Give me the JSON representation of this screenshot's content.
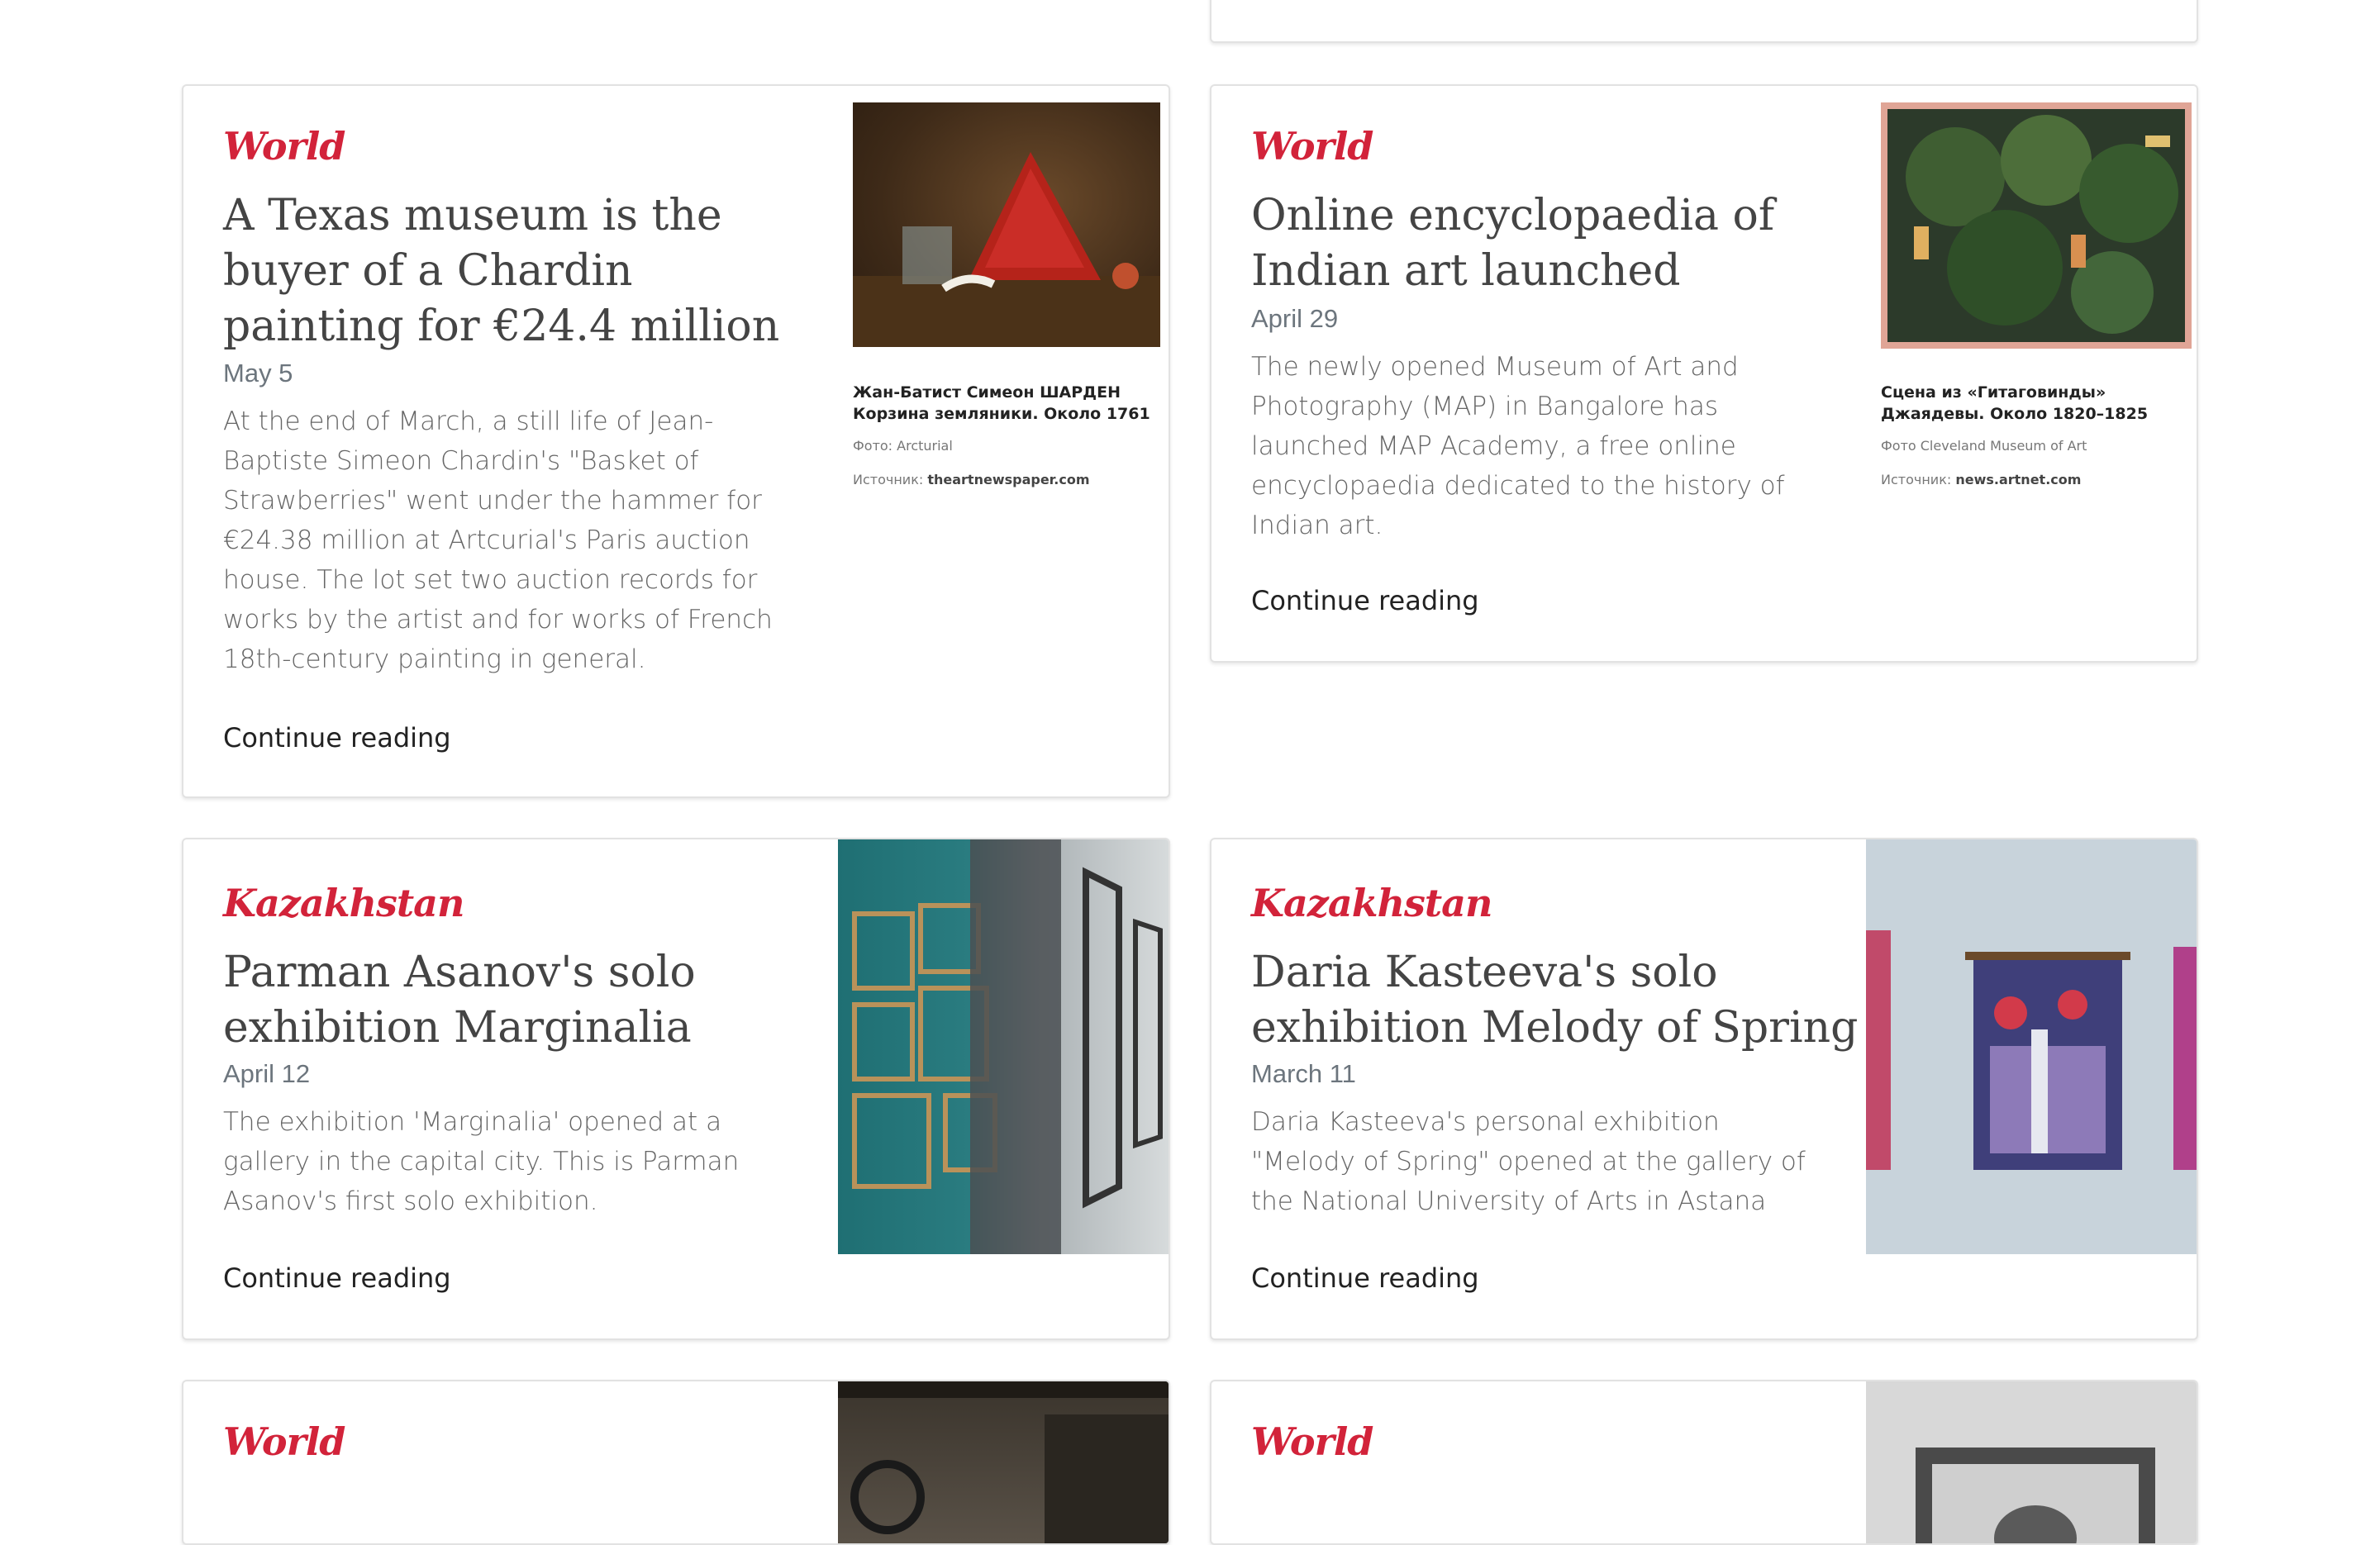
{
  "articles": [
    {
      "tag": "World",
      "title": "A Texas museum is the buyer of a Chardin painting for €24.4 million",
      "date": "May 5",
      "excerpt": "At the end of March, a still life of Jean-Baptiste Simeon Chardin's \"Basket of Strawberries\" went under the hammer for €24.38 million at Artcurial's Paris auction house. The lot set two auction records for works by the artist and for works of French 18th-century painting in general.",
      "link": "Continue reading",
      "caption": {
        "line1": "Жан-Батист Симеон ШАРДЕН",
        "line2": "Корзина земляники. Около 1761",
        "photo": "Фото: Arcturial",
        "source_prefix": "Источник:",
        "source": "theartnewspaper.com"
      }
    },
    {
      "tag": "World",
      "title": "Online encyclopaedia of Indian art launched",
      "date": "April 29",
      "excerpt": "The newly opened Museum of Art and Photography (MAP) in Bangalore has launched MAP Academy, a free online encyclopaedia dedicated to the history of Indian art.",
      "link": "Continue reading",
      "caption": {
        "line1": "Сцена из «Гитаговинды»",
        "line2": "Джаядевы. Около 1820–1825",
        "photo": "Фото Cleveland Museum of Art",
        "source_prefix": "Источник:",
        "source": "news.artnet.com"
      }
    },
    {
      "tag": "Kazakhstan",
      "title": "Parman Asanov's solo exhibition Marginalia",
      "date": "April 12",
      "excerpt": "The exhibition 'Marginalia' opened at a gallery in the capital city. This is Parman Asanov's first solo exhibition.",
      "link": "Continue reading"
    },
    {
      "tag": "Kazakhstan",
      "title": "Daria Kasteeva's solo exhibition Melody of Spring",
      "date": "March 11",
      "excerpt": "Daria Kasteeva's personal exhibition \"Melody of Spring\" opened at the gallery of the National University of Arts in Astana",
      "link": "Continue reading"
    },
    {
      "tag": "World"
    },
    {
      "tag": "World"
    }
  ]
}
